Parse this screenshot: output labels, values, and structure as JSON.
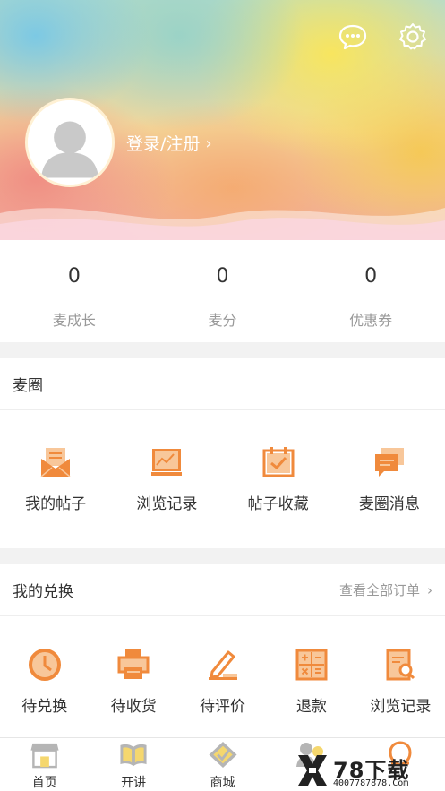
{
  "header": {
    "login_label": "登录/注册",
    "icons": [
      "message-icon",
      "gear-icon",
      "avatar-placeholder",
      "chevron-right-icon"
    ]
  },
  "stats": [
    {
      "value": "0",
      "label": "麦成长"
    },
    {
      "value": "0",
      "label": "麦分"
    },
    {
      "value": "0",
      "label": "优惠券"
    }
  ],
  "maiquan": {
    "title": "麦圈",
    "items": [
      {
        "label": "我的帖子",
        "icon": "envelope-post-icon"
      },
      {
        "label": "浏览记录",
        "icon": "chart-frame-icon"
      },
      {
        "label": "帖子收藏",
        "icon": "calendar-check-icon"
      },
      {
        "label": "麦圈消息",
        "icon": "chat-cards-icon"
      }
    ]
  },
  "exchange": {
    "title": "我的兑换",
    "view_all": "查看全部订单",
    "items": [
      {
        "label": "待兑换",
        "icon": "clock-icon"
      },
      {
        "label": "待收货",
        "icon": "printer-icon"
      },
      {
        "label": "待评价",
        "icon": "pen-icon"
      },
      {
        "label": "退款",
        "icon": "calculator-icon"
      },
      {
        "label": "浏览记录",
        "icon": "document-search-icon"
      }
    ]
  },
  "tabbar": [
    {
      "label": "首页",
      "icon": "store-icon"
    },
    {
      "label": "开讲",
      "icon": "open-book-icon"
    },
    {
      "label": "商城",
      "icon": "tag-check-icon"
    },
    {
      "label": "",
      "icon": "people-icon"
    },
    {
      "label": "",
      "icon": "omega-icon"
    }
  ],
  "watermark": {
    "brand": "78下载",
    "phone": "4007787878.Com"
  },
  "colors": {
    "accent_orange": "#f08a3c",
    "light_orange": "#f8c79a",
    "text_dark": "#333333",
    "text_gray": "#999999",
    "tab_icon_gray": "#b5b5b5",
    "tab_icon_yellow": "#f5d76e"
  }
}
